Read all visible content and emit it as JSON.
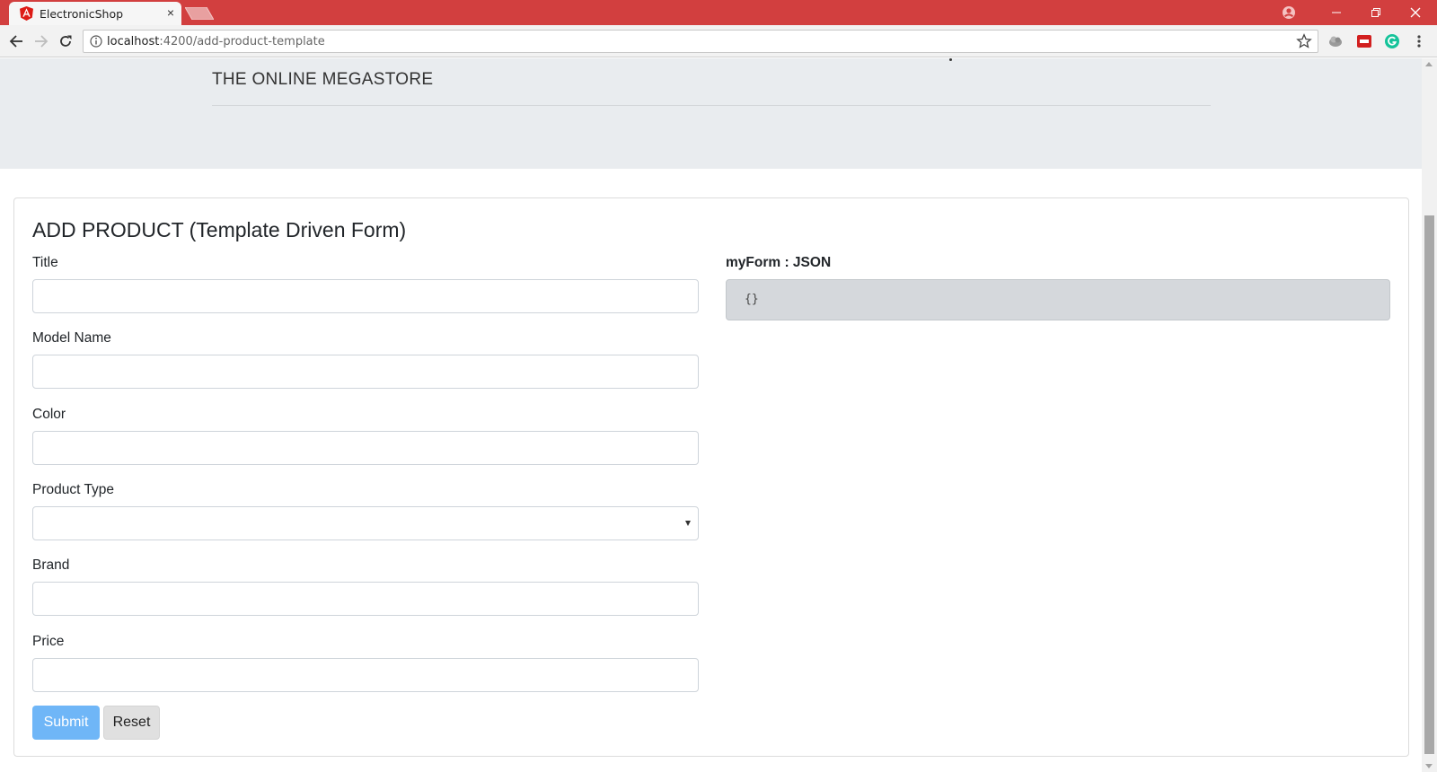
{
  "browser": {
    "tab_title": "ElectronicShop",
    "tab_close": "×",
    "url_host": "localhost",
    "url_rest": ":4200/add-product-template",
    "chrome_color": "#d23f3f"
  },
  "header": {
    "tagline": "THE ONLINE MEGASTORE"
  },
  "form": {
    "title": "ADD PRODUCT (Template Driven Form)",
    "fields": {
      "title": {
        "label": "Title",
        "value": ""
      },
      "model_name": {
        "label": "Model Name",
        "value": ""
      },
      "color": {
        "label": "Color",
        "value": ""
      },
      "product_type": {
        "label": "Product Type",
        "value": ""
      },
      "brand": {
        "label": "Brand",
        "value": ""
      },
      "price": {
        "label": "Price",
        "value": ""
      }
    },
    "submit_label": "Submit",
    "reset_label": "Reset",
    "submit_color": "#6fb6f7"
  },
  "json_panel": {
    "label": "myForm : JSON",
    "content": "{}"
  }
}
